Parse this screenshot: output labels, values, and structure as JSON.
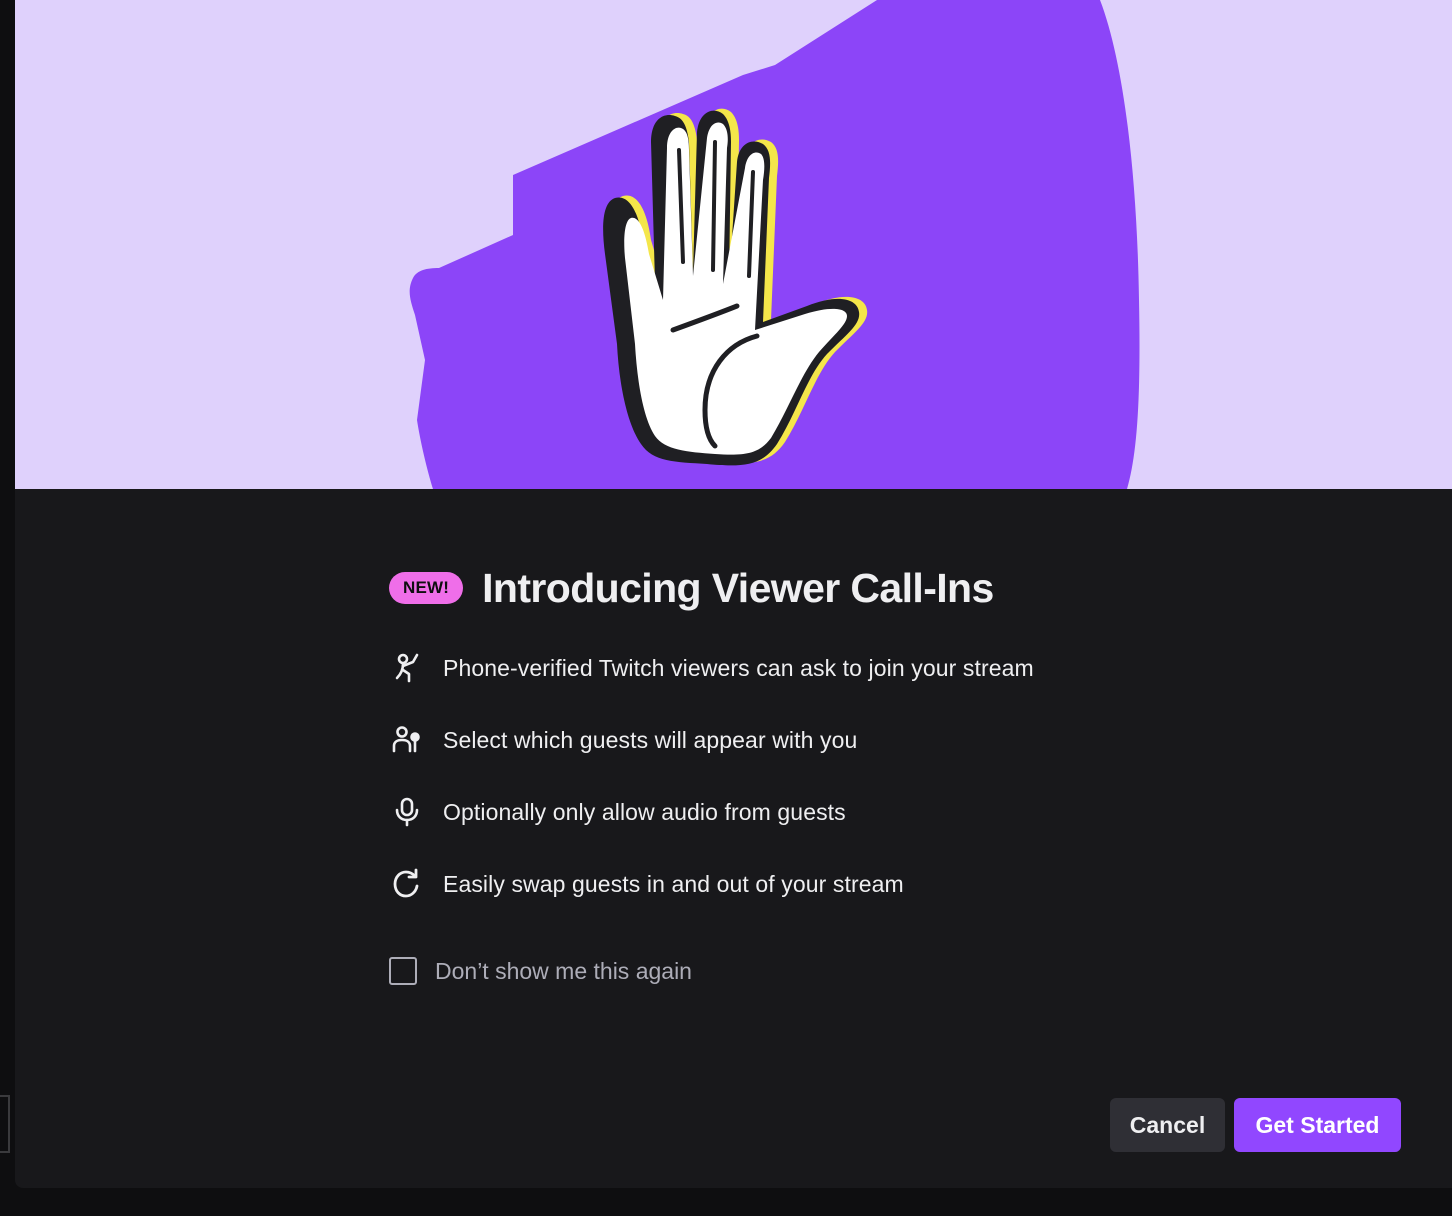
{
  "modal": {
    "badge": "NEW!",
    "title": "Introducing Viewer Call-Ins",
    "features": [
      {
        "icon": "raised-hand-person-icon",
        "text": "Phone-verified Twitch viewers can ask to join your stream"
      },
      {
        "icon": "guests-select-icon",
        "text": "Select which guests will appear with you"
      },
      {
        "icon": "microphone-icon",
        "text": "Optionally only allow audio from guests"
      },
      {
        "icon": "refresh-icon",
        "text": "Easily swap guests in and out of your stream"
      }
    ],
    "checkbox": {
      "label": "Don’t show me this again",
      "checked": false
    },
    "buttons": {
      "cancel": "Cancel",
      "primary": "Get Started"
    }
  },
  "colors": {
    "hero_background": "#dfd1fc",
    "accent_purple": "#9147ff",
    "badge_pink": "#ef6ee9",
    "modal_background": "#18181b"
  }
}
